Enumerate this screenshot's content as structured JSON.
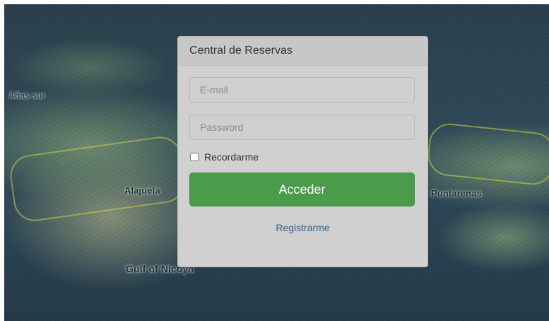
{
  "map": {
    "labels": {
      "top_left": "Añas sur",
      "alajuela": "Alajuela",
      "puntarenas": "Puntarenas",
      "gulf": "Gulf of Nicoya"
    }
  },
  "login": {
    "title": "Central de Reservas",
    "email_placeholder": "E-mail",
    "password_placeholder": "Password",
    "remember_label": "Recordarme",
    "submit_label": "Acceder",
    "register_label": "Registrarme"
  },
  "colors": {
    "primary_button": "#4a9b4a",
    "link": "#2f5f8b"
  },
  "icons": {
    "remember": "checkbox"
  }
}
